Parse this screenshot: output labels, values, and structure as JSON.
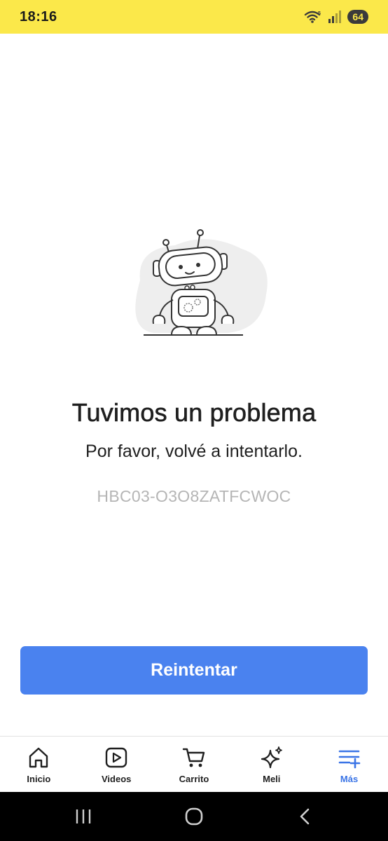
{
  "status_bar": {
    "time": "18:16",
    "battery": "64",
    "icons": [
      "wifi-icon",
      "signal-icon",
      "battery-icon"
    ]
  },
  "error": {
    "title": "Tuvimos un problema",
    "message": "Por favor, volvé a intentarlo.",
    "code": "HBC03-O3O8ZATFCWOC",
    "illustration": "robot-illustration"
  },
  "actions": {
    "retry_label": "Reintentar",
    "retry_color": "#4a82ef"
  },
  "bottom_nav": {
    "items": [
      {
        "label": "Inicio",
        "icon": "home-icon",
        "active": false
      },
      {
        "label": "Videos",
        "icon": "video-play-icon",
        "active": false
      },
      {
        "label": "Carrito",
        "icon": "cart-icon",
        "active": false
      },
      {
        "label": "Meli",
        "icon": "sparkle-icon",
        "active": false
      },
      {
        "label": "Más",
        "icon": "menu-plus-icon",
        "active": true
      }
    ],
    "active_color": "#3a74e6"
  },
  "system_nav": {
    "buttons": [
      "recent-apps-icon",
      "home-circle-icon",
      "back-icon"
    ]
  },
  "colors": {
    "status_bar": "#fbe84a",
    "error_code": "#b5b5b5"
  }
}
